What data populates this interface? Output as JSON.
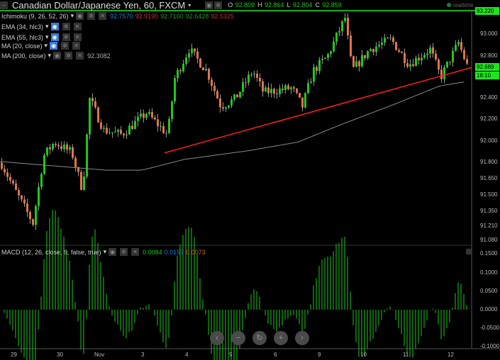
{
  "header": {
    "title": "Canadian Dollar/Japanese Yen, 60, FXCM",
    "o_label": "O",
    "o": "92.809",
    "h_label": "H",
    "h": "92.864",
    "l_label": "L",
    "l": "92.804",
    "c_label": "C",
    "c": "92.859",
    "realtime": "realtime"
  },
  "indicators": [
    {
      "label": "Ichimoku (9, 26, 52, 26)",
      "values": [
        "92.7570",
        "92.9190",
        "92.7160",
        "92.6428",
        "92.5325"
      ]
    },
    {
      "label": "EMA (34, hlc3)"
    },
    {
      "label": "EMA (55, hlc3)"
    },
    {
      "label": "MA (20, close)"
    },
    {
      "label": "MA (200, close)",
      "value": "92.3082"
    }
  ],
  "macd": {
    "label": "MACD (12, 26, close, 9, false, true)",
    "values": [
      "0.0084",
      "0.0157",
      "0.0073"
    ],
    "axis": [
      "0.1500",
      "0.1000",
      "0.0500",
      "0.0000",
      "-0.0500",
      "-0.1000"
    ]
  },
  "price_axis": [
    "93.000",
    "92.800",
    "92.400",
    "92.200",
    "92.000",
    "91.800",
    "91.650",
    "91.500",
    "91.350",
    "91.210",
    "91.080"
  ],
  "markers": {
    "high_line": "93.220",
    "last": "92.689",
    "countdown": "18:10"
  },
  "x_axis": [
    "29",
    "30",
    "Nov",
    "3",
    "4",
    "5",
    "6",
    "9",
    "10",
    "11",
    "12"
  ],
  "nav": [
    "‹",
    "−",
    "↻",
    "+",
    "›"
  ],
  "colors": {
    "up": "#1ec81e",
    "down": "#e0744a",
    "trend": "#ff2020",
    "ma200": "#888888"
  },
  "chart_data": {
    "type": "candlestick",
    "ylim": [
      91.08,
      93.25
    ],
    "price_path": [
      [
        0,
        91.81
      ],
      [
        20,
        91.55
      ],
      [
        45,
        91.25
      ],
      [
        60,
        91.87
      ],
      [
        75,
        92.0
      ],
      [
        100,
        91.9
      ],
      [
        115,
        91.55
      ],
      [
        125,
        92.4
      ],
      [
        145,
        92.11
      ],
      [
        170,
        92.07
      ],
      [
        205,
        92.27
      ],
      [
        235,
        92.07
      ],
      [
        245,
        92.59
      ],
      [
        265,
        92.86
      ],
      [
        290,
        92.66
      ],
      [
        310,
        92.33
      ],
      [
        330,
        92.4
      ],
      [
        355,
        92.66
      ],
      [
        370,
        92.46
      ],
      [
        410,
        92.5
      ],
      [
        425,
        92.33
      ],
      [
        440,
        92.66
      ],
      [
        460,
        92.79
      ],
      [
        485,
        93.15
      ],
      [
        495,
        92.66
      ],
      [
        520,
        92.86
      ],
      [
        550,
        92.95
      ],
      [
        575,
        92.72
      ],
      [
        605,
        92.86
      ],
      [
        620,
        92.6
      ],
      [
        645,
        92.92
      ],
      [
        658,
        92.69
      ]
    ],
    "ma200": [
      [
        0,
        91.82
      ],
      [
        150,
        91.74
      ],
      [
        200,
        91.74
      ],
      [
        260,
        91.84
      ],
      [
        350,
        91.92
      ],
      [
        420,
        92.0
      ],
      [
        480,
        92.16
      ],
      [
        560,
        92.36
      ],
      [
        620,
        92.52
      ],
      [
        658,
        92.56
      ]
    ],
    "trendline": [
      [
        232,
        91.9
      ],
      [
        665,
        92.69
      ]
    ]
  }
}
